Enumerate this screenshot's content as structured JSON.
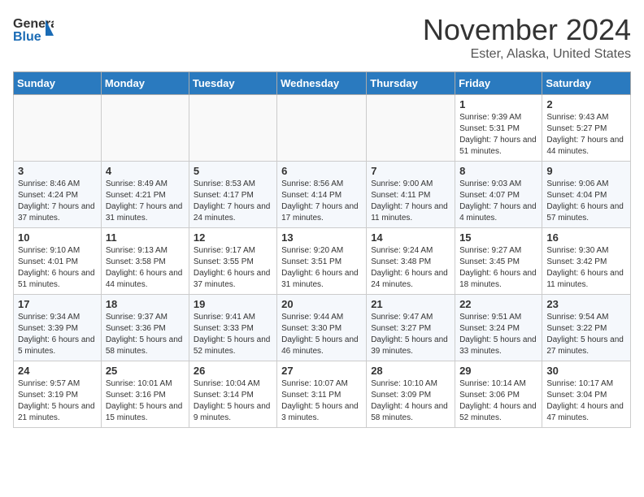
{
  "header": {
    "logo_general": "General",
    "logo_blue": "Blue",
    "month_year": "November 2024",
    "location": "Ester, Alaska, United States"
  },
  "days_of_week": [
    "Sunday",
    "Monday",
    "Tuesday",
    "Wednesday",
    "Thursday",
    "Friday",
    "Saturday"
  ],
  "weeks": [
    [
      {
        "day": "",
        "info": ""
      },
      {
        "day": "",
        "info": ""
      },
      {
        "day": "",
        "info": ""
      },
      {
        "day": "",
        "info": ""
      },
      {
        "day": "",
        "info": ""
      },
      {
        "day": "1",
        "info": "Sunrise: 9:39 AM\nSunset: 5:31 PM\nDaylight: 7 hours and 51 minutes."
      },
      {
        "day": "2",
        "info": "Sunrise: 9:43 AM\nSunset: 5:27 PM\nDaylight: 7 hours and 44 minutes."
      }
    ],
    [
      {
        "day": "3",
        "info": "Sunrise: 8:46 AM\nSunset: 4:24 PM\nDaylight: 7 hours and 37 minutes."
      },
      {
        "day": "4",
        "info": "Sunrise: 8:49 AM\nSunset: 4:21 PM\nDaylight: 7 hours and 31 minutes."
      },
      {
        "day": "5",
        "info": "Sunrise: 8:53 AM\nSunset: 4:17 PM\nDaylight: 7 hours and 24 minutes."
      },
      {
        "day": "6",
        "info": "Sunrise: 8:56 AM\nSunset: 4:14 PM\nDaylight: 7 hours and 17 minutes."
      },
      {
        "day": "7",
        "info": "Sunrise: 9:00 AM\nSunset: 4:11 PM\nDaylight: 7 hours and 11 minutes."
      },
      {
        "day": "8",
        "info": "Sunrise: 9:03 AM\nSunset: 4:07 PM\nDaylight: 7 hours and 4 minutes."
      },
      {
        "day": "9",
        "info": "Sunrise: 9:06 AM\nSunset: 4:04 PM\nDaylight: 6 hours and 57 minutes."
      }
    ],
    [
      {
        "day": "10",
        "info": "Sunrise: 9:10 AM\nSunset: 4:01 PM\nDaylight: 6 hours and 51 minutes."
      },
      {
        "day": "11",
        "info": "Sunrise: 9:13 AM\nSunset: 3:58 PM\nDaylight: 6 hours and 44 minutes."
      },
      {
        "day": "12",
        "info": "Sunrise: 9:17 AM\nSunset: 3:55 PM\nDaylight: 6 hours and 37 minutes."
      },
      {
        "day": "13",
        "info": "Sunrise: 9:20 AM\nSunset: 3:51 PM\nDaylight: 6 hours and 31 minutes."
      },
      {
        "day": "14",
        "info": "Sunrise: 9:24 AM\nSunset: 3:48 PM\nDaylight: 6 hours and 24 minutes."
      },
      {
        "day": "15",
        "info": "Sunrise: 9:27 AM\nSunset: 3:45 PM\nDaylight: 6 hours and 18 minutes."
      },
      {
        "day": "16",
        "info": "Sunrise: 9:30 AM\nSunset: 3:42 PM\nDaylight: 6 hours and 11 minutes."
      }
    ],
    [
      {
        "day": "17",
        "info": "Sunrise: 9:34 AM\nSunset: 3:39 PM\nDaylight: 6 hours and 5 minutes."
      },
      {
        "day": "18",
        "info": "Sunrise: 9:37 AM\nSunset: 3:36 PM\nDaylight: 5 hours and 58 minutes."
      },
      {
        "day": "19",
        "info": "Sunrise: 9:41 AM\nSunset: 3:33 PM\nDaylight: 5 hours and 52 minutes."
      },
      {
        "day": "20",
        "info": "Sunrise: 9:44 AM\nSunset: 3:30 PM\nDaylight: 5 hours and 46 minutes."
      },
      {
        "day": "21",
        "info": "Sunrise: 9:47 AM\nSunset: 3:27 PM\nDaylight: 5 hours and 39 minutes."
      },
      {
        "day": "22",
        "info": "Sunrise: 9:51 AM\nSunset: 3:24 PM\nDaylight: 5 hours and 33 minutes."
      },
      {
        "day": "23",
        "info": "Sunrise: 9:54 AM\nSunset: 3:22 PM\nDaylight: 5 hours and 27 minutes."
      }
    ],
    [
      {
        "day": "24",
        "info": "Sunrise: 9:57 AM\nSunset: 3:19 PM\nDaylight: 5 hours and 21 minutes."
      },
      {
        "day": "25",
        "info": "Sunrise: 10:01 AM\nSunset: 3:16 PM\nDaylight: 5 hours and 15 minutes."
      },
      {
        "day": "26",
        "info": "Sunrise: 10:04 AM\nSunset: 3:14 PM\nDaylight: 5 hours and 9 minutes."
      },
      {
        "day": "27",
        "info": "Sunrise: 10:07 AM\nSunset: 3:11 PM\nDaylight: 5 hours and 3 minutes."
      },
      {
        "day": "28",
        "info": "Sunrise: 10:10 AM\nSunset: 3:09 PM\nDaylight: 4 hours and 58 minutes."
      },
      {
        "day": "29",
        "info": "Sunrise: 10:14 AM\nSunset: 3:06 PM\nDaylight: 4 hours and 52 minutes."
      },
      {
        "day": "30",
        "info": "Sunrise: 10:17 AM\nSunset: 3:04 PM\nDaylight: 4 hours and 47 minutes."
      }
    ]
  ]
}
